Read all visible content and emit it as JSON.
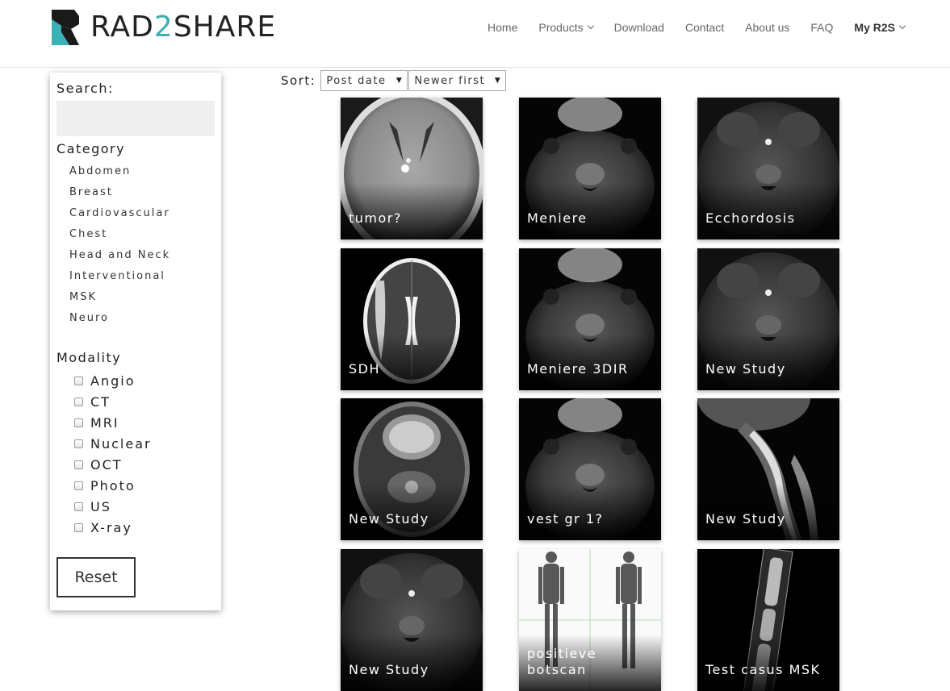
{
  "brand": {
    "name_part1": "RAD",
    "name_accent": "2",
    "name_part2": "SHARE",
    "accent_color": "#3bb0b6"
  },
  "nav": [
    {
      "label": "Home",
      "dropdown": false
    },
    {
      "label": "Products",
      "dropdown": true
    },
    {
      "label": "Download",
      "dropdown": false
    },
    {
      "label": "Contact",
      "dropdown": false
    },
    {
      "label": "About us",
      "dropdown": false
    },
    {
      "label": "FAQ",
      "dropdown": false
    },
    {
      "label": "My R2S",
      "dropdown": true
    }
  ],
  "sidebar": {
    "search_label": "Search:",
    "search_value": "",
    "category_label": "Category",
    "categories": [
      "Abdomen",
      "Breast",
      "Cardiovascular",
      "Chest",
      "Head and Neck",
      "Interventional",
      "MSK",
      "Neuro"
    ],
    "modality_label": "Modality",
    "modalities": [
      "Angio",
      "CT",
      "MRI",
      "Nuclear",
      "OCT",
      "Photo",
      "US",
      "X-ray"
    ],
    "reset_label": "Reset"
  },
  "sort": {
    "label": "Sort:",
    "field_value": "Post date",
    "order_value": "Newer first"
  },
  "studies": [
    {
      "title": "tumor?",
      "image": "ct-brain"
    },
    {
      "title": "Meniere",
      "image": "mri-posterior-fossa"
    },
    {
      "title": "Ecchordosis",
      "image": "mri-skull-base"
    },
    {
      "title": "SDH",
      "image": "mri-brain-axial"
    },
    {
      "title": "Meniere 3DIR",
      "image": "mri-posterior-fossa"
    },
    {
      "title": "New Study",
      "image": "mri-skull-base"
    },
    {
      "title": "New Study",
      "image": "mri-face-axial"
    },
    {
      "title": "vest gr 1?",
      "image": "mri-posterior-fossa"
    },
    {
      "title": "New Study",
      "image": "mri-spine-sagittal"
    },
    {
      "title": "New Study",
      "image": "mri-skull-base"
    },
    {
      "title": "positieve botscan",
      "image": "bone-scan"
    },
    {
      "title": "Test casus MSK",
      "image": "xray-finger"
    }
  ]
}
